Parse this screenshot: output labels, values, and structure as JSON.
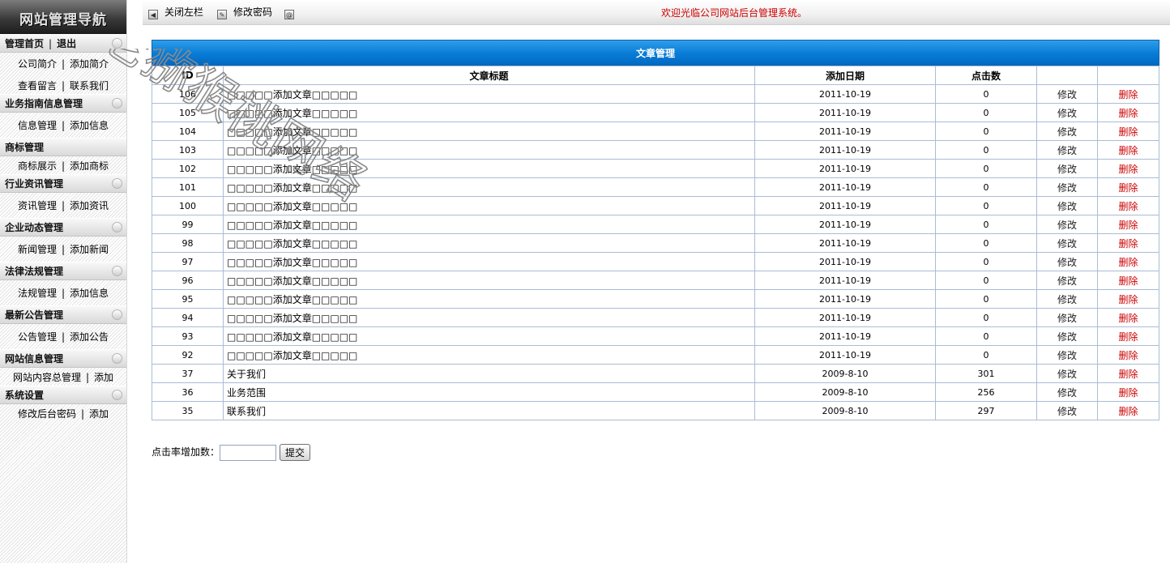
{
  "sidebar": {
    "logo": "网站管理导航",
    "top": {
      "home": "管理首页",
      "logout": "退出",
      "sep": "|"
    },
    "sections": [
      {
        "title": "",
        "links": [
          "公司简介",
          "添加简介"
        ]
      },
      {
        "title": "",
        "links": [
          "查看留言",
          "联系我们"
        ]
      },
      {
        "title": "业务指南信息管理",
        "links": [
          "信息管理",
          "添加信息"
        ]
      },
      {
        "title": "商标管理",
        "links": [
          "商标展示",
          "添加商标"
        ]
      },
      {
        "title": "行业资讯管理",
        "links": [
          "资讯管理",
          "添加资讯"
        ]
      },
      {
        "title": "企业动态管理",
        "links": [
          "新闻管理",
          "添加新闻"
        ]
      },
      {
        "title": "法律法规管理",
        "links": [
          "法规管理",
          "添加信息"
        ]
      },
      {
        "title": "最新公告管理",
        "links": [
          "公告管理",
          "添加公告"
        ]
      },
      {
        "title": "网站信息管理",
        "links": [
          "网站内容总管理",
          "添加"
        ]
      },
      {
        "title": "系统设置",
        "links": [
          "修改后台密码",
          "添加"
        ]
      }
    ]
  },
  "topbar": {
    "close_sidebar": "关闭左栏",
    "change_password": "修改密码",
    "welcome": "欢迎光临公司网站后台管理系统。"
  },
  "table": {
    "caption": "文章管理",
    "headers": [
      "ID",
      "文章标题",
      "添加日期",
      "点击数",
      "",
      ""
    ],
    "edit_label": "修改",
    "delete_label": "删除",
    "rows": [
      {
        "id": "106",
        "title": "□□□□□添加文章□□□□□",
        "date": "2011-10-19",
        "clicks": "0"
      },
      {
        "id": "105",
        "title": "□□□□□添加文章□□□□□",
        "date": "2011-10-19",
        "clicks": "0"
      },
      {
        "id": "104",
        "title": "□□□□□添加文章□□□□□",
        "date": "2011-10-19",
        "clicks": "0"
      },
      {
        "id": "103",
        "title": "□□□□□添加文章□□□□□",
        "date": "2011-10-19",
        "clicks": "0"
      },
      {
        "id": "102",
        "title": "□□□□□添加文章□□□□□",
        "date": "2011-10-19",
        "clicks": "0"
      },
      {
        "id": "101",
        "title": "□□□□□添加文章□□□□□",
        "date": "2011-10-19",
        "clicks": "0"
      },
      {
        "id": "100",
        "title": "□□□□□添加文章□□□□□",
        "date": "2011-10-19",
        "clicks": "0"
      },
      {
        "id": "99",
        "title": "□□□□□添加文章□□□□□",
        "date": "2011-10-19",
        "clicks": "0"
      },
      {
        "id": "98",
        "title": "□□□□□添加文章□□□□□",
        "date": "2011-10-19",
        "clicks": "0"
      },
      {
        "id": "97",
        "title": "□□□□□添加文章□□□□□",
        "date": "2011-10-19",
        "clicks": "0"
      },
      {
        "id": "96",
        "title": "□□□□□添加文章□□□□□",
        "date": "2011-10-19",
        "clicks": "0"
      },
      {
        "id": "95",
        "title": "□□□□□添加文章□□□□□",
        "date": "2011-10-19",
        "clicks": "0"
      },
      {
        "id": "94",
        "title": "□□□□□添加文章□□□□□",
        "date": "2011-10-19",
        "clicks": "0"
      },
      {
        "id": "93",
        "title": "□□□□□添加文章□□□□□",
        "date": "2011-10-19",
        "clicks": "0"
      },
      {
        "id": "92",
        "title": "□□□□□添加文章□□□□□",
        "date": "2011-10-19",
        "clicks": "0"
      },
      {
        "id": "37",
        "title": "关于我们",
        "date": "2009-8-10",
        "clicks": "301"
      },
      {
        "id": "36",
        "title": "业务范围",
        "date": "2009-8-10",
        "clicks": "256"
      },
      {
        "id": "35",
        "title": "联系我们",
        "date": "2009-8-10",
        "clicks": "297"
      }
    ]
  },
  "form": {
    "label": "点击率增加数：",
    "input_value": "",
    "submit_label": "提交"
  },
  "watermark": {
    "text": "老猕猴桃网络"
  },
  "colors": {
    "header_blue": "#0a7ed8",
    "welcome_red": "#cc0000",
    "delete_red": "#cc0000",
    "grid_border": "#a9bdd6"
  }
}
